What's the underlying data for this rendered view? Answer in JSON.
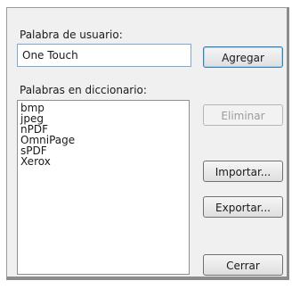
{
  "dialog": {
    "user_word_label": "Palabra de usuario:",
    "user_word_value": "One Touch",
    "dictionary_label": "Palabras en diccionario:",
    "dictionary_words": [
      "bmp",
      "jpeg",
      "nPDF",
      "OmniPage",
      "sPDF",
      "Xerox"
    ],
    "buttons": {
      "add": "Agregar",
      "delete": "Eliminar",
      "import": "Importar...",
      "export": "Exportar...",
      "close": "Cerrar"
    }
  },
  "colors": {
    "panel_background": "#f0f0f0",
    "focused_input_border": "#7aaad5",
    "default_button_border": "#3c7fb1",
    "disabled_text": "#9c9c9c"
  }
}
